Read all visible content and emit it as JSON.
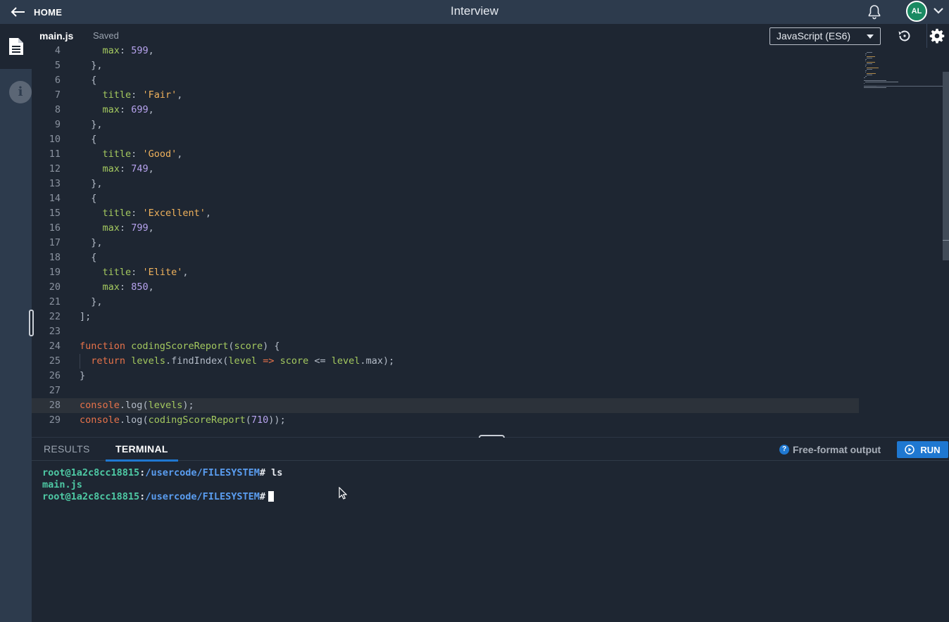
{
  "header": {
    "back_label": "HOME",
    "title": "Interview",
    "avatar_initials": "AL"
  },
  "editor": {
    "file_name": "main.js",
    "save_status": "Saved",
    "language": "JavaScript (ES6)",
    "lines": [
      {
        "n": "4",
        "text": "    max: 599,"
      },
      {
        "n": "5",
        "text": "  },"
      },
      {
        "n": "6",
        "text": "  {"
      },
      {
        "n": "7",
        "text": "    title: 'Fair',"
      },
      {
        "n": "8",
        "text": "    max: 699,"
      },
      {
        "n": "9",
        "text": "  },"
      },
      {
        "n": "10",
        "text": "  {"
      },
      {
        "n": "11",
        "text": "    title: 'Good',"
      },
      {
        "n": "12",
        "text": "    max: 749,"
      },
      {
        "n": "13",
        "text": "  },"
      },
      {
        "n": "14",
        "text": "  {"
      },
      {
        "n": "15",
        "text": "    title: 'Excellent',"
      },
      {
        "n": "16",
        "text": "    max: 799,"
      },
      {
        "n": "17",
        "text": "  },"
      },
      {
        "n": "18",
        "text": "  {"
      },
      {
        "n": "19",
        "text": "    title: 'Elite',"
      },
      {
        "n": "20",
        "text": "    max: 850,"
      },
      {
        "n": "21",
        "text": "  },"
      },
      {
        "n": "22",
        "text": "];"
      },
      {
        "n": "23",
        "text": ""
      },
      {
        "n": "24",
        "text": "function codingScoreReport(score) {"
      },
      {
        "n": "25",
        "text": "  return levels.findIndex(level => score <= level.max);"
      },
      {
        "n": "26",
        "text": "}"
      },
      {
        "n": "27",
        "text": ""
      },
      {
        "n": "28",
        "text": "console.log(levels);"
      },
      {
        "n": "29",
        "text": "console.log(codingScoreReport(710));"
      }
    ],
    "highlighted_line": "28"
  },
  "bottom_panel": {
    "tabs": [
      {
        "label": "RESULTS",
        "active": false
      },
      {
        "label": "TERMINAL",
        "active": true
      }
    ],
    "help_label": "Free-format output",
    "run_label": "RUN",
    "terminal": {
      "host": "root@1a2c8cc18815",
      "path": "/usercode/FILESYSTEM",
      "prompt_char": "#",
      "command_1": "ls",
      "output_1": "main.js"
    }
  },
  "colors": {
    "topbar": "#2d3b4d",
    "background": "#1e2632",
    "accent": "#1f78d1",
    "avatar": "#1a8a62"
  },
  "icons": [
    "back-arrow-icon",
    "bell-icon",
    "chevron-down-icon",
    "file-icon",
    "info-icon",
    "reset-icon",
    "gear-icon",
    "help-icon",
    "play-icon"
  ]
}
